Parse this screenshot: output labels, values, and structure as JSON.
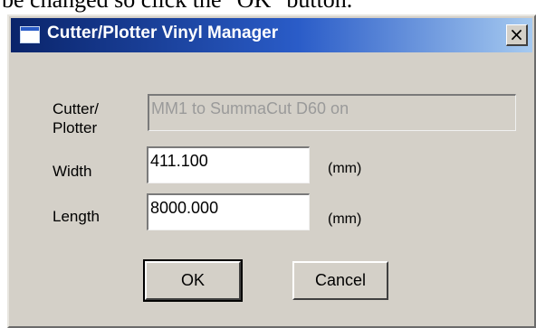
{
  "background_text": "be changed so click the \"OK\" button.",
  "window": {
    "title": "Cutter/Plotter Vinyl Manager",
    "close_symbol": "×"
  },
  "form": {
    "plotter_label": "Cutter/\nPlotter",
    "plotter_value": "MM1 to SummaCut D60 on",
    "width_label": "Width",
    "width_value": "411.100",
    "width_unit": "(mm)",
    "length_label": "Length",
    "length_value": "8000.000",
    "length_unit": "(mm)"
  },
  "buttons": {
    "ok_label": "OK",
    "cancel_label": "Cancel"
  },
  "colors": {
    "title_gradient_start": "#0a246a",
    "title_gradient_end": "#a6caf0",
    "dialog_face": "#d4d0c8"
  },
  "icons": {
    "window": "window-icon",
    "close": "close-icon"
  }
}
